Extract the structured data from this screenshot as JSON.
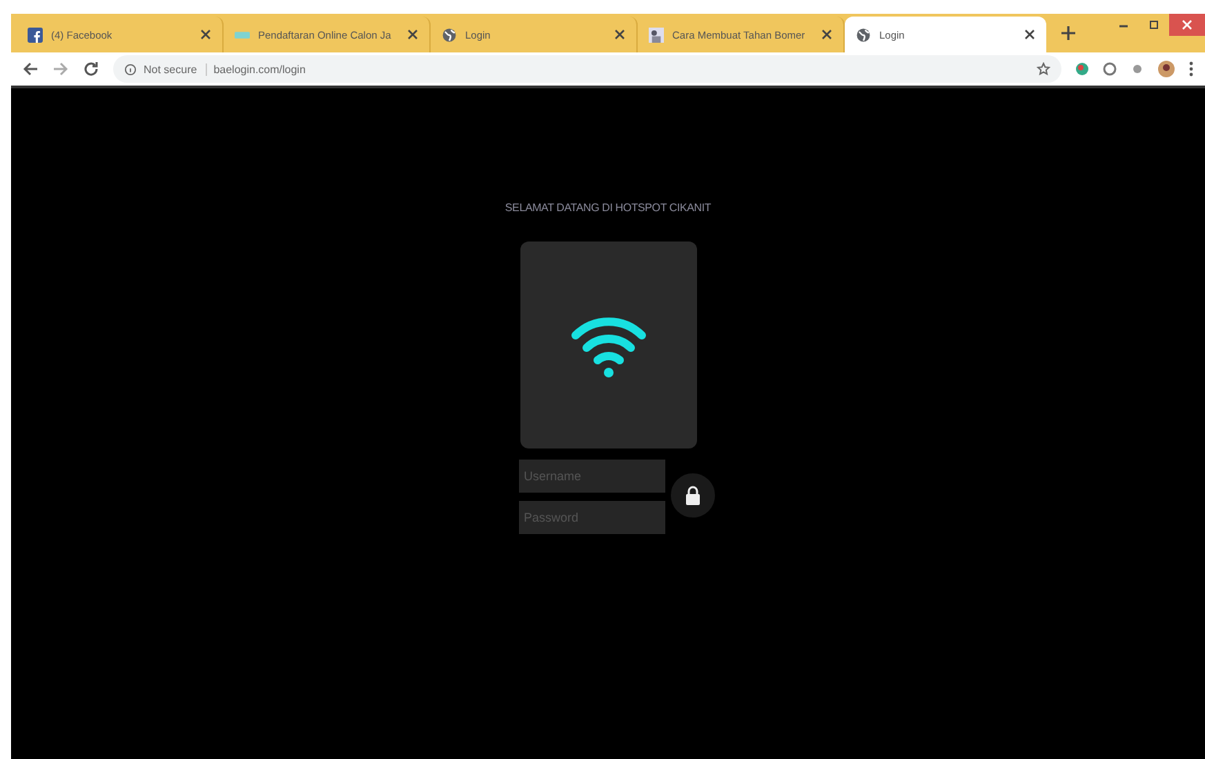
{
  "browser": {
    "tabs": [
      {
        "title": "(4) Facebook",
        "selected": false
      },
      {
        "title": "Pendaftaran Online Calon Ja",
        "selected": false
      },
      {
        "title": "Login",
        "selected": false
      },
      {
        "title": "Cara Membuat Tahan Bomer",
        "selected": false
      },
      {
        "title": "Login",
        "selected": true
      }
    ],
    "security": "Not secure",
    "url": "baelogin.com/login"
  },
  "page": {
    "heading": "SELAMAT DATANG DI HOTSPOT CIKANIT",
    "fields": [
      {
        "placeholder": "Username"
      },
      {
        "placeholder": "Password"
      }
    ]
  }
}
